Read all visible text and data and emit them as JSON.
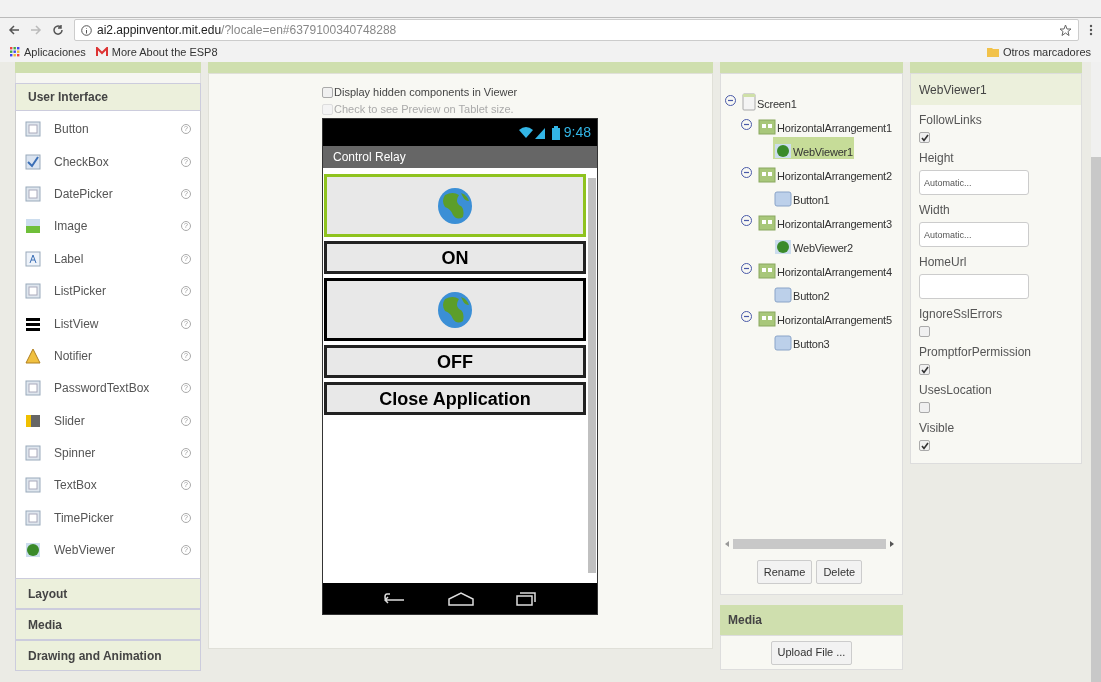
{
  "browser": {
    "url_host": "ai2.appinventor.mit.edu",
    "url_path": "/?locale=en#6379100340748288",
    "bookmarks": [
      "Aplicaciones",
      "More About the ESP8"
    ],
    "other_bookmarks": "Otros marcadores"
  },
  "palette": {
    "open_section": "User Interface",
    "items": [
      {
        "label": "Button"
      },
      {
        "label": "CheckBox"
      },
      {
        "label": "DatePicker"
      },
      {
        "label": "Image"
      },
      {
        "label": "Label"
      },
      {
        "label": "ListPicker"
      },
      {
        "label": "ListView"
      },
      {
        "label": "Notifier"
      },
      {
        "label": "PasswordTextBox"
      },
      {
        "label": "Slider"
      },
      {
        "label": "Spinner"
      },
      {
        "label": "TextBox"
      },
      {
        "label": "TimePicker"
      },
      {
        "label": "WebViewer"
      }
    ],
    "help_mark": "?",
    "sections": [
      "Layout",
      "Media",
      "Drawing and Animation"
    ]
  },
  "viewer": {
    "options": [
      {
        "label": "Display hidden components in Viewer",
        "checked": false,
        "disabled": false
      },
      {
        "label": "Check to see Preview on Tablet size.",
        "checked": false,
        "disabled": true
      }
    ],
    "phone": {
      "time": "9:48",
      "title": "Control Relay",
      "elements": [
        {
          "kind": "webviewer",
          "selected": true
        },
        {
          "kind": "button",
          "text": "ON"
        },
        {
          "kind": "webviewer",
          "selected": false
        },
        {
          "kind": "button",
          "text": "OFF"
        },
        {
          "kind": "button",
          "text": "Close Application"
        }
      ]
    }
  },
  "components": {
    "tree": [
      {
        "label": "Screen1",
        "kind": "screen",
        "expanded": true,
        "selected": false,
        "children": [
          {
            "label": "HorizontalArrangement1",
            "kind": "arrangement",
            "expanded": true,
            "selected": false,
            "children": [
              {
                "label": "WebViewer1",
                "kind": "webviewer",
                "selected": true
              }
            ]
          },
          {
            "label": "HorizontalArrangement2",
            "kind": "arrangement",
            "expanded": true,
            "selected": false,
            "children": [
              {
                "label": "Button1",
                "kind": "button",
                "selected": false
              }
            ]
          },
          {
            "label": "HorizontalArrangement3",
            "kind": "arrangement",
            "expanded": true,
            "selected": false,
            "children": [
              {
                "label": "WebViewer2",
                "kind": "webviewer",
                "selected": false
              }
            ]
          },
          {
            "label": "HorizontalArrangement4",
            "kind": "arrangement",
            "expanded": true,
            "selected": false,
            "children": [
              {
                "label": "Button2",
                "kind": "button",
                "selected": false
              }
            ]
          },
          {
            "label": "HorizontalArrangement5",
            "kind": "arrangement",
            "expanded": true,
            "selected": false,
            "children": [
              {
                "label": "Button3",
                "kind": "button",
                "selected": false
              }
            ]
          }
        ]
      }
    ],
    "buttons": [
      "Rename",
      "Delete"
    ]
  },
  "media": {
    "title": "Media",
    "button": "Upload File ..."
  },
  "properties": {
    "component": "WebViewer1",
    "items": [
      {
        "label": "FollowLinks",
        "kind": "checkbox",
        "checked": true
      },
      {
        "label": "Height",
        "kind": "text",
        "value": "Automatic..."
      },
      {
        "label": "Width",
        "kind": "text",
        "value": "Automatic..."
      },
      {
        "label": "HomeUrl",
        "kind": "text"
      },
      {
        "label": "IgnoreSslErrors",
        "kind": "checkbox",
        "checked": false
      },
      {
        "label": "PromptforPermission",
        "kind": "checkbox",
        "checked": true
      },
      {
        "label": "UsesLocation",
        "kind": "checkbox",
        "checked": false
      },
      {
        "label": "Visible",
        "kind": "checkbox",
        "checked": true
      }
    ]
  }
}
